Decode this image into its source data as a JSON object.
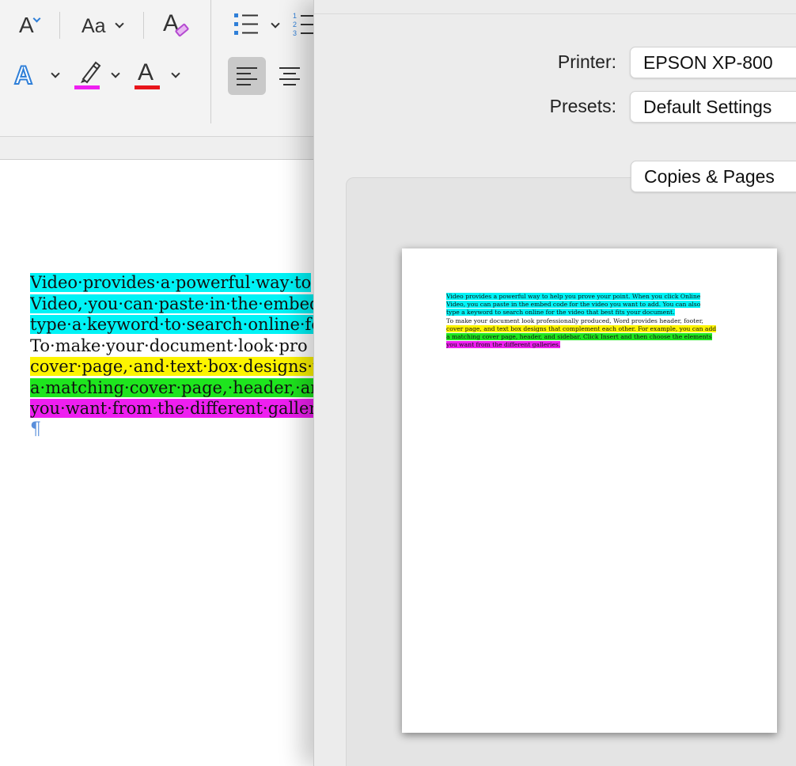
{
  "ribbon": {
    "icons": {
      "font_size_up": "font-size-increase-icon",
      "change_case": "change-case-icon",
      "clear_format": "clear-formatting-icon",
      "bullets": "bullet-list-icon",
      "numbering": "numbered-list-icon",
      "text_effects": "text-effects-icon",
      "highlight": "highlighter-icon",
      "font_color": "font-color-icon",
      "align_left": "align-left-icon",
      "align_center": "align-center-icon"
    },
    "glyphs": {
      "font_size_up": "A",
      "change_case": "Aa",
      "clear_format": "A",
      "text_effects": "A",
      "font_color": "A"
    },
    "colors": {
      "highlight_bar": "#ee1ff0",
      "font_color_bar": "#e8141b",
      "accent_blue": "#2f7fd8"
    }
  },
  "document": {
    "lines": [
      {
        "text": "Video·provides·a·powerful·way·to",
        "highlight": "cyan"
      },
      {
        "text": "Video,·you·can·paste·in·the·embed",
        "highlight": "cyan"
      },
      {
        "text": "type·a·keyword·to·search·online·fo",
        "highlight": "cyan"
      },
      {
        "text": "To·make·your·document·look·pro",
        "highlight": "none"
      },
      {
        "text": "cover·page,·and·text·box·designs·t",
        "highlight": "yellow"
      },
      {
        "text": "a·matching·cover·page,·header,·ar",
        "highlight": "green"
      },
      {
        "text": "you·want·from·the·different·galler",
        "highlight": "magenta"
      }
    ],
    "pilcrow": "¶"
  },
  "print_dialog": {
    "printer_label": "Printer:",
    "printer_value": "EPSON XP-800",
    "presets_label": "Presets:",
    "presets_value": "Default Settings",
    "section_popup": "Copies & Pages",
    "preview_lines": [
      {
        "text": "Video provides a powerful way to help you prove your point. When you click Online",
        "highlight": "cyan"
      },
      {
        "text": "Video, you can paste in the embed code for the video you want to add. You can also",
        "highlight": "cyan"
      },
      {
        "text": "type a keyword to search online for the video that best fits your document.",
        "highlight": "cyan"
      },
      {
        "text": "To make your document look professionally produced, Word provides header, footer,",
        "highlight": "none"
      },
      {
        "text": "cover page, and text box designs that complement each other. For example, you can add",
        "highlight": "yellow"
      },
      {
        "text": "a matching cover page, header, and sidebar. Click Insert and then choose the elements",
        "highlight": "green"
      },
      {
        "text": "you want from the different galleries.",
        "highlight": "magenta"
      }
    ]
  }
}
